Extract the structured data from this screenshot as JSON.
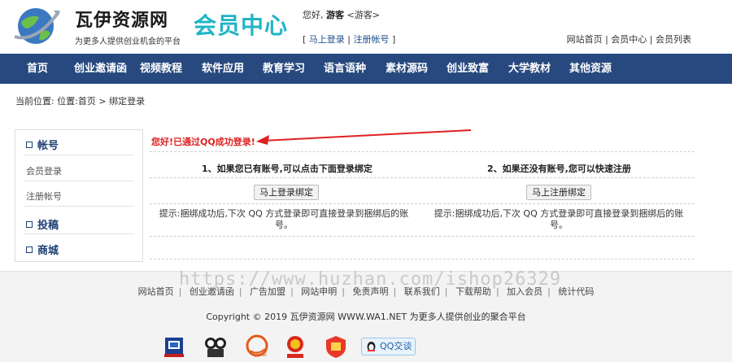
{
  "header": {
    "site_name": "瓦伊资源网",
    "slogan": "为更多人提供创业机会的平台",
    "member_center": "会员中心",
    "greeting_prefix": "您好,",
    "user_name": "游客",
    "user_role": "<游客>",
    "login_link": "马上登录",
    "register_link": "注册帐号",
    "top_links": [
      "网站首页",
      "会员中心",
      "会员列表"
    ]
  },
  "nav": {
    "items": [
      "首页",
      "创业邀请函",
      "视频教程",
      "软件应用",
      "教育学习",
      "语言语种",
      "素材源码",
      "创业致富",
      "大学教材",
      "其他资源"
    ]
  },
  "breadcrumb": {
    "text": "当前位置: 位置:首页 > 绑定登录"
  },
  "sidebar": {
    "account_title": "帐号",
    "account_items": [
      "会员登录",
      "注册帐号"
    ],
    "contribute_title": "投稿",
    "shop_title": "商城"
  },
  "main": {
    "success_message": "您好!已通过QQ成功登录!",
    "left": {
      "title": "1、如果您已有账号,可以点击下面登录绑定",
      "button": "马上登录绑定",
      "tip": "提示:捆绑成功后,下次 QQ 方式登录即可直接登录到捆绑后的账号。"
    },
    "right": {
      "title": "2、如果还没有账号,您可以快速注册",
      "button": "马上注册绑定",
      "tip": "提示:捆绑成功后,下次 QQ 方式登录即可直接登录到捆绑后的账号。"
    }
  },
  "footer": {
    "links": [
      "网站首页",
      "创业邀请函",
      "广告加盟",
      "网站申明",
      "免责声明",
      "联系我们",
      "下载帮助",
      "加入会员",
      "统计代码"
    ],
    "copyright": "Copyright © 2019 瓦伊资源网 WWW.WA1.NET 为更多人提供创业的聚合平台",
    "qq_badge": "QQ交谈",
    "badges": [
      "police-badge-icon",
      "cyber-police-icon",
      "qiuw-icon",
      "gov-emblem-icon",
      "security-badge-icon"
    ]
  },
  "watermark": "https://www.huzhan.com/ishop26329",
  "colors": {
    "nav_bg": "#27497f",
    "member_center": "#1fb5c5",
    "success_red": "#e02020",
    "sidebar_head": "#1f3f74"
  }
}
